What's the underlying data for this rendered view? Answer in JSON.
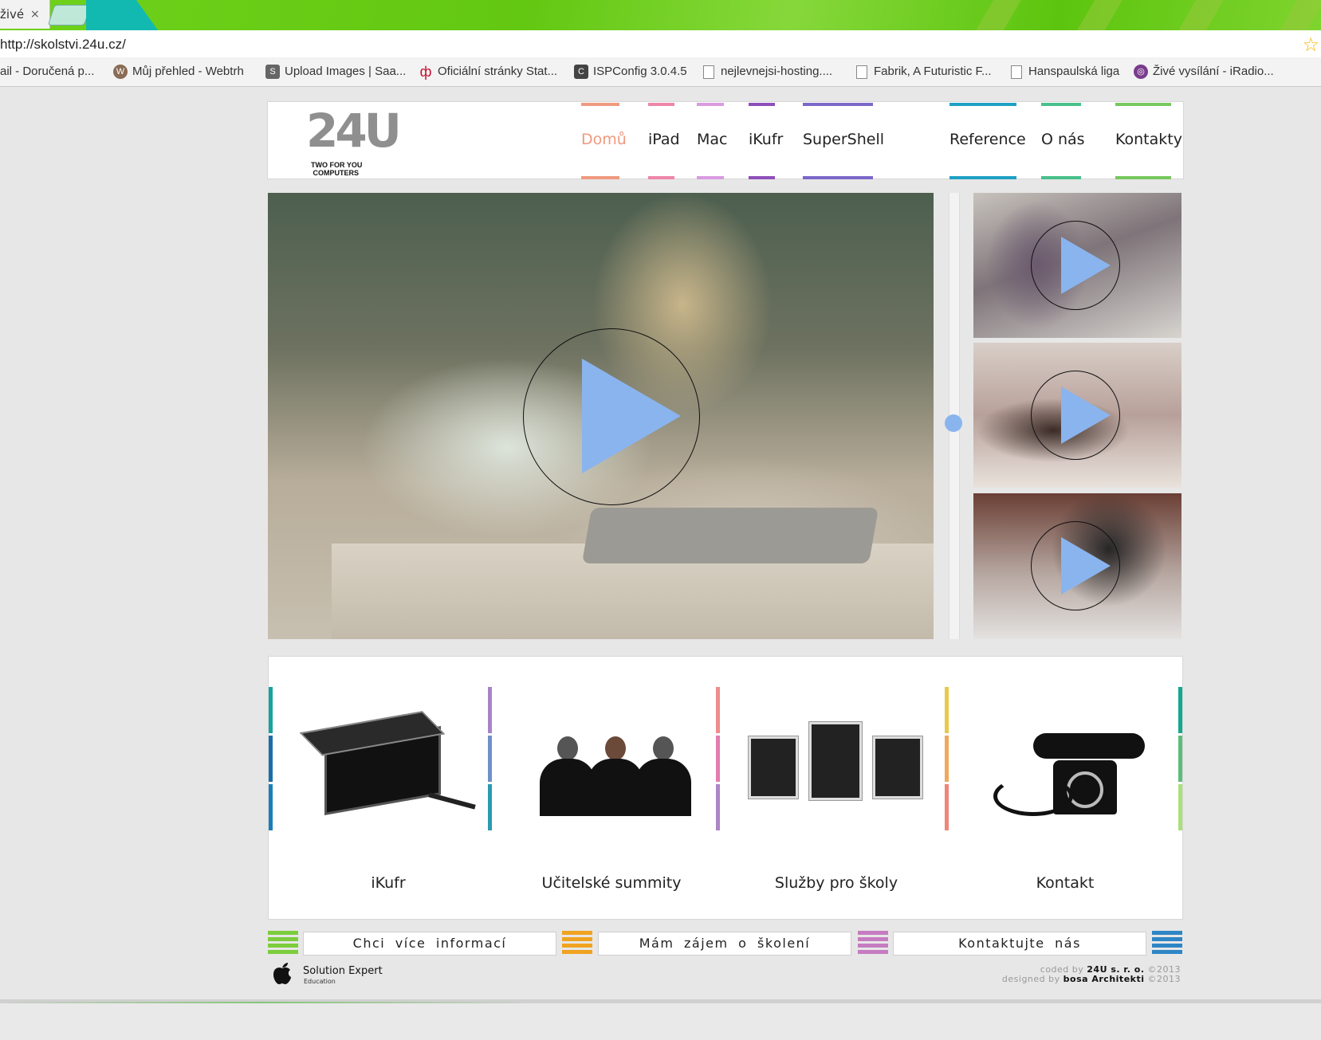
{
  "browser": {
    "tab_title": "živé",
    "tab_close": "×",
    "url": "http://skolstvi.24u.cz/",
    "bookmarks": [
      {
        "label": "ail - Doručená p...",
        "icon": "mail-icon"
      },
      {
        "label": "Můj přehled - Webtrh",
        "icon": "webtrh-icon"
      },
      {
        "label": "Upload Images | Saa...",
        "icon": "saa-icon"
      },
      {
        "label": "Oficiální stránky Stat...",
        "icon": "stat-icon"
      },
      {
        "label": "ISPConfig 3.0.4.5",
        "icon": "ispconfig-icon"
      },
      {
        "label": "nejlevnejsi-hosting....",
        "icon": "page-icon"
      },
      {
        "label": "Fabrik, A Futuristic F...",
        "icon": "page-icon"
      },
      {
        "label": "Hanspaulská liga",
        "icon": "page-icon"
      },
      {
        "label": "Živé vysílání - iRadio...",
        "icon": "iradio-icon"
      }
    ]
  },
  "site": {
    "logo": {
      "number": "24U",
      "tagline_1": "TWO FOR YOU",
      "tagline_2": "COMPUTERS"
    },
    "nav": [
      {
        "label": "Domů",
        "color": "#ef9a7f",
        "active": true
      },
      {
        "label": "iPad",
        "color": "#ee86a8"
      },
      {
        "label": "Mac",
        "color": "#d99be0"
      },
      {
        "label": "iKufr",
        "color": "#8e4fba"
      },
      {
        "label": "SuperShell",
        "color": "#7b68c9"
      },
      {
        "label": "Reference",
        "color": "#1fa0c4"
      },
      {
        "label": "O nás",
        "color": "#48c08a"
      },
      {
        "label": "Kontakty",
        "color": "#77c85f"
      }
    ],
    "active_nav_color": "#ef9a7f",
    "play_color": "#8ab4ee",
    "features": [
      {
        "caption": "iKufr",
        "icon": "case-icon"
      },
      {
        "caption": "Učitelské summity",
        "icon": "teachers-icon"
      },
      {
        "caption": "Služby pro školy",
        "icon": "tablets-icon"
      },
      {
        "caption": "Kontakt",
        "icon": "telephone-icon"
      }
    ],
    "cta": [
      {
        "label": "Chci více informací",
        "stripe_color": "#7ccd3c"
      },
      {
        "label": "Mám zájem o školení",
        "stripe_color": "#f0a321"
      },
      {
        "label": "Kontaktujte nás",
        "stripe_color": "#c67cc0"
      }
    ],
    "cta_end_stripe_color": "#2e86c5",
    "footer": {
      "se_title": "Solution Expert",
      "se_sub": "Education",
      "coded_by_prefix": "coded by",
      "coded_by": "24U s. r. o.",
      "coded_year": "©2013",
      "designed_by_prefix": "designed by",
      "designed_by": "bosa Architekti",
      "designed_year": "©2013"
    }
  }
}
